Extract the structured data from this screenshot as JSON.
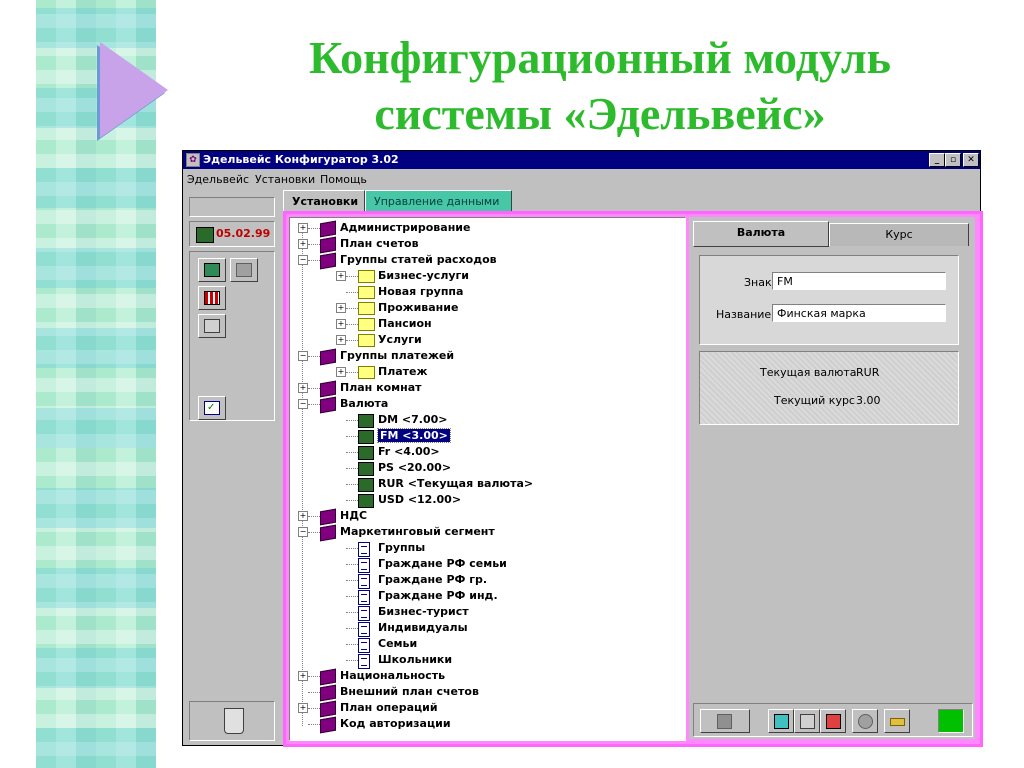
{
  "slide": {
    "title_line1": "Конфигурационный модуль",
    "title_line2": "системы «Эдельвейс»"
  },
  "window": {
    "title": "Эдельвейс Конфигуратор 3.02",
    "menu": [
      "Эдельвейс",
      "Установки",
      "Помощь"
    ],
    "date": "05.02.99"
  },
  "tabs": {
    "main_active": "Установки",
    "main_inactive": "Управление данными"
  },
  "tree": {
    "items": [
      {
        "label": "Администрирование",
        "level": 0,
        "icon": "book-icon",
        "expander": "+"
      },
      {
        "label": "План счетов",
        "level": 0,
        "icon": "book-icon",
        "expander": "+"
      },
      {
        "label": "Группы статей расходов",
        "level": 0,
        "icon": "book-icon",
        "expander": "-"
      },
      {
        "label": "Бизнес-услуги",
        "level": 1,
        "icon": "folder-icon",
        "expander": "+"
      },
      {
        "label": "Новая группа",
        "level": 1,
        "icon": "folder-icon",
        "expander": ""
      },
      {
        "label": "Проживание",
        "level": 1,
        "icon": "folder-icon",
        "expander": "+"
      },
      {
        "label": "Пансион",
        "level": 1,
        "icon": "folder-icon",
        "expander": "+"
      },
      {
        "label": "Услуги",
        "level": 1,
        "icon": "folder-icon",
        "expander": "+"
      },
      {
        "label": "Группы платежей",
        "level": 0,
        "icon": "book-icon",
        "expander": "-"
      },
      {
        "label": "Платеж",
        "level": 1,
        "icon": "folder-icon",
        "expander": "+"
      },
      {
        "label": "План комнат",
        "level": 0,
        "icon": "book-icon",
        "expander": "+"
      },
      {
        "label": "Валюта",
        "level": 0,
        "icon": "book-icon",
        "expander": "-"
      },
      {
        "label": "DM  <7.00>",
        "level": 1,
        "icon": "money-icon",
        "expander": ""
      },
      {
        "label": "FM  <3.00>",
        "level": 1,
        "icon": "money-icon",
        "expander": "",
        "selected": true
      },
      {
        "label": "Fr  <4.00>",
        "level": 1,
        "icon": "money-icon",
        "expander": ""
      },
      {
        "label": "PS  <20.00>",
        "level": 1,
        "icon": "money-icon",
        "expander": ""
      },
      {
        "label": "RUR  <Текущая валюта>",
        "level": 1,
        "icon": "money-icon",
        "expander": ""
      },
      {
        "label": "USD  <12.00>",
        "level": 1,
        "icon": "money-icon",
        "expander": ""
      },
      {
        "label": "НДС",
        "level": 0,
        "icon": "book-icon",
        "expander": "+"
      },
      {
        "label": "Маркетинговый сегмент",
        "level": 0,
        "icon": "book-icon",
        "expander": "-"
      },
      {
        "label": "Группы",
        "level": 1,
        "icon": "document-icon",
        "expander": ""
      },
      {
        "label": "Граждане РФ семьи",
        "level": 1,
        "icon": "document-icon",
        "expander": ""
      },
      {
        "label": "Граждане РФ гр.",
        "level": 1,
        "icon": "document-icon",
        "expander": ""
      },
      {
        "label": "Граждане РФ инд.",
        "level": 1,
        "icon": "document-icon",
        "expander": ""
      },
      {
        "label": "Бизнес-турист",
        "level": 1,
        "icon": "document-icon",
        "expander": ""
      },
      {
        "label": "Индивидуалы",
        "level": 1,
        "icon": "document-icon",
        "expander": ""
      },
      {
        "label": "Семьи",
        "level": 1,
        "icon": "document-icon",
        "expander": ""
      },
      {
        "label": "Школьники",
        "level": 1,
        "icon": "document-icon",
        "expander": ""
      },
      {
        "label": "Национальность",
        "level": 0,
        "icon": "book-icon",
        "expander": "+"
      },
      {
        "label": "Внешний план счетов",
        "level": 0,
        "icon": "book-icon",
        "expander": ""
      },
      {
        "label": "План операций",
        "level": 0,
        "icon": "book-icon",
        "expander": "+"
      },
      {
        "label": "Код авторизации",
        "level": 0,
        "icon": "book-icon",
        "expander": ""
      }
    ]
  },
  "detail": {
    "tab_active": "Валюта",
    "tab_inactive": "Курс",
    "sign_label": "Знак",
    "sign_value": "FM",
    "name_label": "Название",
    "name_value": "Финская марка",
    "current_currency_label": "Текущая валюта",
    "current_currency_value": "RUR",
    "current_rate_label": "Текущий курс",
    "current_rate_value": "3.00"
  },
  "colors": {
    "slide_title": "#2dbb2d",
    "titlebar": "#000080",
    "tab_frame": "#ff66ff",
    "inactive_tab": "#48c7a6",
    "status_indicator": "#00c000"
  }
}
